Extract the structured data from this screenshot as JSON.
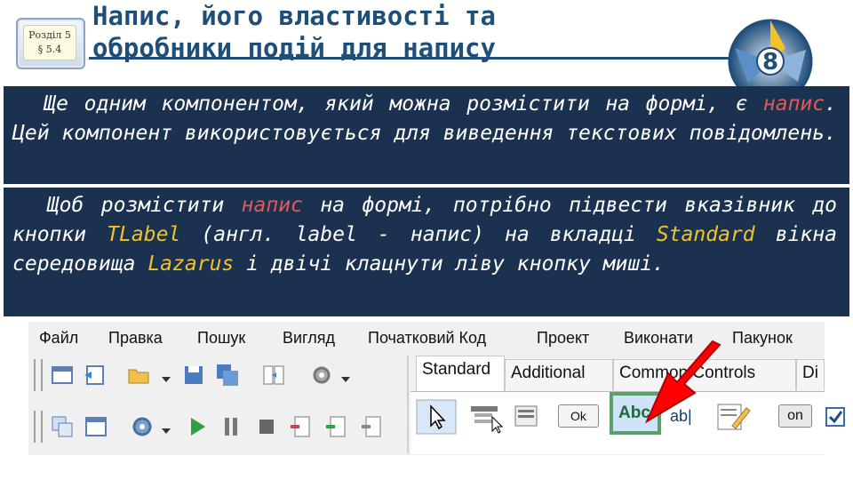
{
  "header": {
    "section_badge_line1": "Розділ 5",
    "section_badge_line2": "§ 5.4",
    "title_line1": "Напис, його властивості та",
    "title_line2": "обробники подій для напису",
    "grade_number": "8"
  },
  "paragraph1": {
    "part1": "Ще одним компонентом, який можна розмістити на формі, є ",
    "highlight": "напис",
    "part2": ". Цей компонент використовується для виведення текстових повідомлень."
  },
  "paragraph2": {
    "part1": "Щоб розмістити ",
    "highlight1": "напис",
    "part2": " на формі, потрібно підвести вказівник до кнопки ",
    "kw1": "TLabel",
    "part3": " (англ. label - напис) на вкладці ",
    "kw2": "Standard",
    "part4": " вікна середовища ",
    "kw3": "Lazarus",
    "part5": " і двічі клацнути ліву кнопку миші."
  },
  "ide": {
    "menu": [
      "Файл",
      "Правка",
      "Пошук",
      "Вигляд",
      "Початковий Код",
      "Проект",
      "Виконати",
      "Пакунок"
    ],
    "tabs": [
      "Standard",
      "Additional",
      "Common Controls",
      "Di"
    ],
    "palette": {
      "button_ok": "Ok",
      "label_button": "Abc",
      "edit_button": "ab|",
      "toggle_button": "on"
    }
  },
  "colors": {
    "title": "#1f4e79",
    "textbox_bg": "#1a3150",
    "highlight_red": "#e05a5a",
    "keyword_yellow": "#f2c229",
    "arrow_red": "#ff0000",
    "label_button_border": "#5aa06a"
  }
}
